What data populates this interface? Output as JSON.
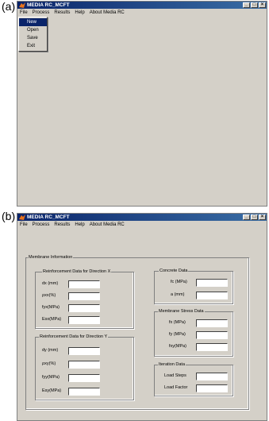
{
  "panel_a": {
    "label": "(a)",
    "window_title": "MEDIA RC_MCFT",
    "menu": [
      "File",
      "Process",
      "Results",
      "Help",
      "About Media RC"
    ],
    "file_menu_items": [
      "New",
      "Open",
      "Save",
      "Exit"
    ],
    "selected_item": "New"
  },
  "panel_b": {
    "label": "(b)",
    "window_title": "MEDIA RC_MCFT",
    "menu": [
      "File",
      "Process",
      "Results",
      "Help",
      "About Media RC"
    ],
    "membrane_group": "Membrane Information",
    "reinf_x": {
      "title": "Reinforcement Data for Direction X",
      "fields": [
        "dx (mm)",
        "ρxx(%)",
        "fyx(MPa)",
        "Esx(MPa)"
      ]
    },
    "reinf_y": {
      "title": "Reinforcement Data for Direction Y",
      "fields": [
        "dy (mm)",
        "ρxy(%)",
        "fyy(MPa)",
        "Esy(MPa)"
      ]
    },
    "concrete": {
      "title": "Concrete Data",
      "fields": [
        "fc (MPa)",
        "a (mm)"
      ]
    },
    "stress": {
      "title": "Membrane Stress Data",
      "fields": [
        "fx (MPa)",
        "fy (MPa)",
        "fxy(MPa)"
      ]
    },
    "iteration": {
      "title": "Iteration Data",
      "fields": [
        "Load Steps",
        "Load Factor"
      ]
    }
  }
}
